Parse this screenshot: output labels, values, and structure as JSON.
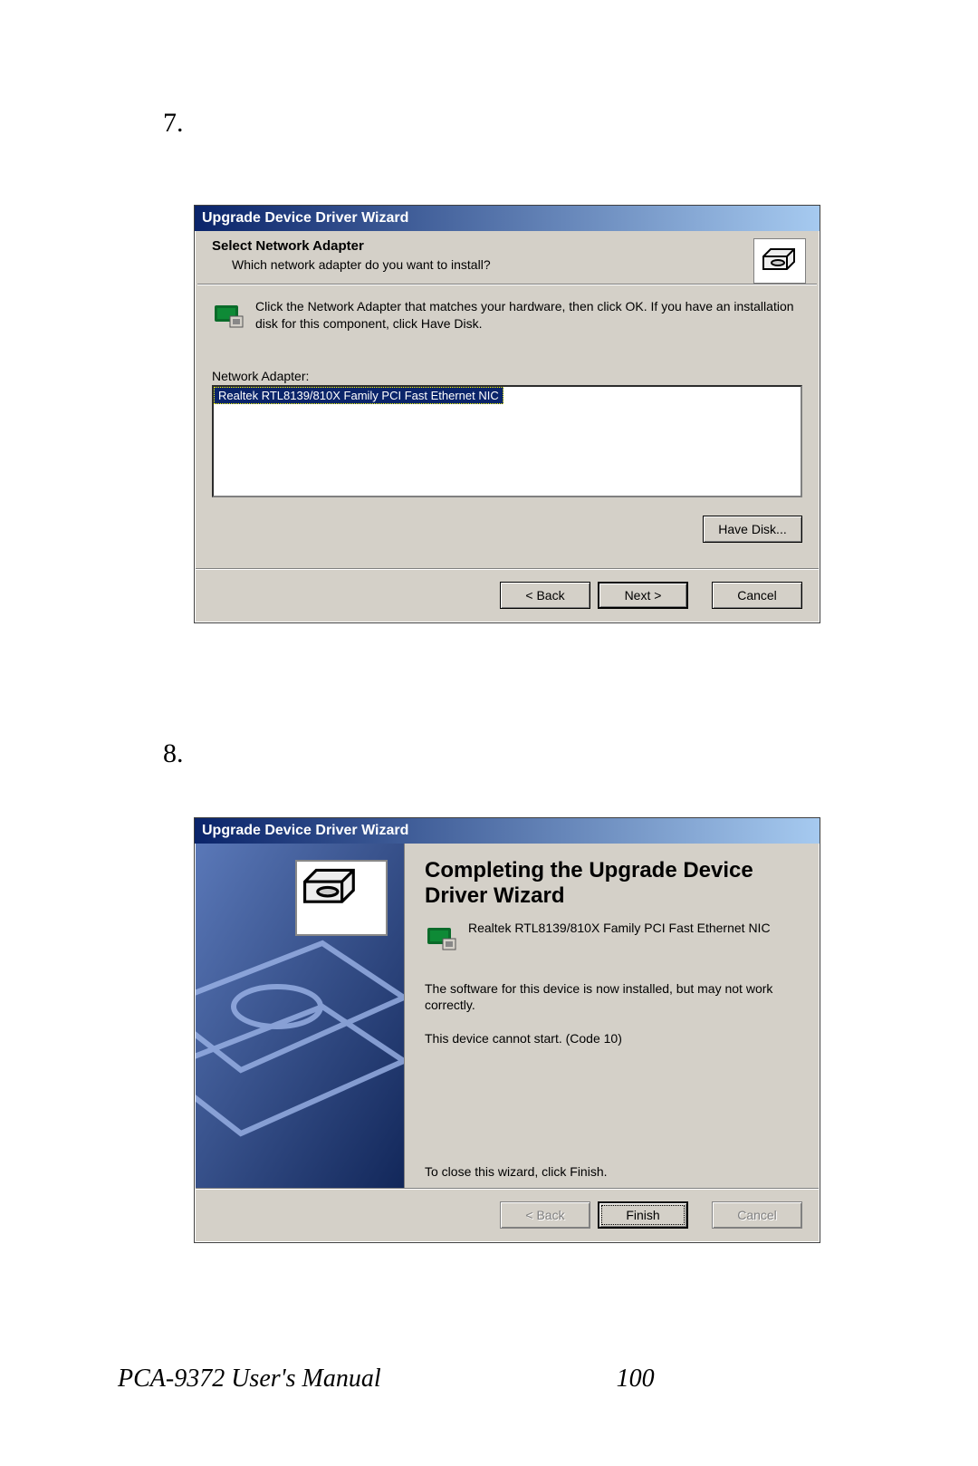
{
  "steps": {
    "first": "7.",
    "second": "8."
  },
  "footer": {
    "title": "PCA-9372 User's Manual",
    "page": "100"
  },
  "dialog1": {
    "title": "Upgrade Device Driver Wizard",
    "heading": "Select Network Adapter",
    "subheading": "Which network adapter do you want to install?",
    "instruction": "Click the Network Adapter that matches your hardware, then click OK. If you have an installation disk for this component, click Have Disk.",
    "list_label": "Network Adapter:",
    "list_item": "Realtek RTL8139/810X Family PCI Fast Ethernet NIC",
    "have_disk": "Have Disk...",
    "back": "< Back",
    "next": "Next >",
    "cancel": "Cancel"
  },
  "dialog2": {
    "title": "Upgrade Device Driver Wizard",
    "heading": "Completing the Upgrade Device Driver Wizard",
    "product": "Realtek RTL8139/810X Family PCI Fast Ethernet NIC",
    "msg1": "The software for this device is now installed, but may not work correctly.",
    "msg2": "This device cannot start. (Code 10)",
    "close_hint": "To close this wizard, click Finish.",
    "back": "< Back",
    "finish": "Finish",
    "cancel": "Cancel"
  }
}
